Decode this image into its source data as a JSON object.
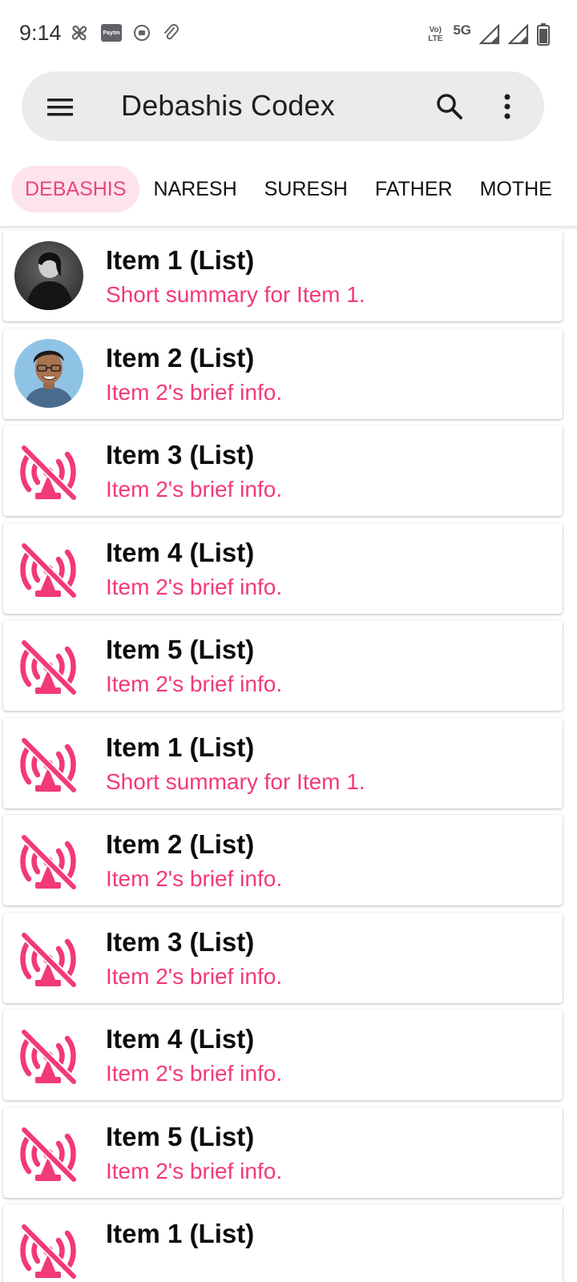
{
  "status_bar": {
    "time": "9:14",
    "left_icons": [
      "pinwheel-icon",
      "paytm-icon",
      "record-icon",
      "attachment-icon"
    ],
    "lte_label": "Vo) LTE",
    "network_label": "5G",
    "right_icons": [
      "signal-icon",
      "signal-icon",
      "battery-icon"
    ]
  },
  "app_bar": {
    "title": "Debashis Codex",
    "menu_icon": "menu-icon",
    "search_icon": "search-icon",
    "more_icon": "more-vertical-icon"
  },
  "tabs": [
    {
      "label": "DEBASHIS",
      "active": true
    },
    {
      "label": "NARESH",
      "active": false
    },
    {
      "label": "SURESH",
      "active": false
    },
    {
      "label": "FATHER",
      "active": false
    },
    {
      "label": "MOTHE",
      "active": false
    }
  ],
  "colors": {
    "accent": "#f2397a",
    "tab_active_bg": "#fde3ea",
    "tab_active_text": "#e8477a",
    "app_bar_bg": "#ebebeb"
  },
  "items": [
    {
      "title": "Item 1 (List)",
      "subtitle": "Short summary for Item 1.",
      "thumb": "avatar-photo-dark"
    },
    {
      "title": "Item 2 (List)",
      "subtitle": "Item 2's brief info.",
      "thumb": "avatar-photo-man"
    },
    {
      "title": "Item 3 (List)",
      "subtitle": "Item 2's brief info.",
      "thumb": "no-signal-icon"
    },
    {
      "title": "Item 4 (List)",
      "subtitle": "Item 2's brief info.",
      "thumb": "no-signal-icon"
    },
    {
      "title": "Item 5 (List)",
      "subtitle": "Item 2's brief info.",
      "thumb": "no-signal-icon"
    },
    {
      "title": "Item 1 (List)",
      "subtitle": "Short summary for Item 1.",
      "thumb": "no-signal-icon"
    },
    {
      "title": "Item 2 (List)",
      "subtitle": "Item 2's brief info.",
      "thumb": "no-signal-icon"
    },
    {
      "title": "Item 3 (List)",
      "subtitle": "Item 2's brief info.",
      "thumb": "no-signal-icon"
    },
    {
      "title": "Item 4 (List)",
      "subtitle": "Item 2's brief info.",
      "thumb": "no-signal-icon"
    },
    {
      "title": "Item 5 (List)",
      "subtitle": "Item 2's brief info.",
      "thumb": "no-signal-icon"
    },
    {
      "title": "Item 1 (List)",
      "subtitle": "",
      "thumb": "no-signal-icon"
    }
  ]
}
